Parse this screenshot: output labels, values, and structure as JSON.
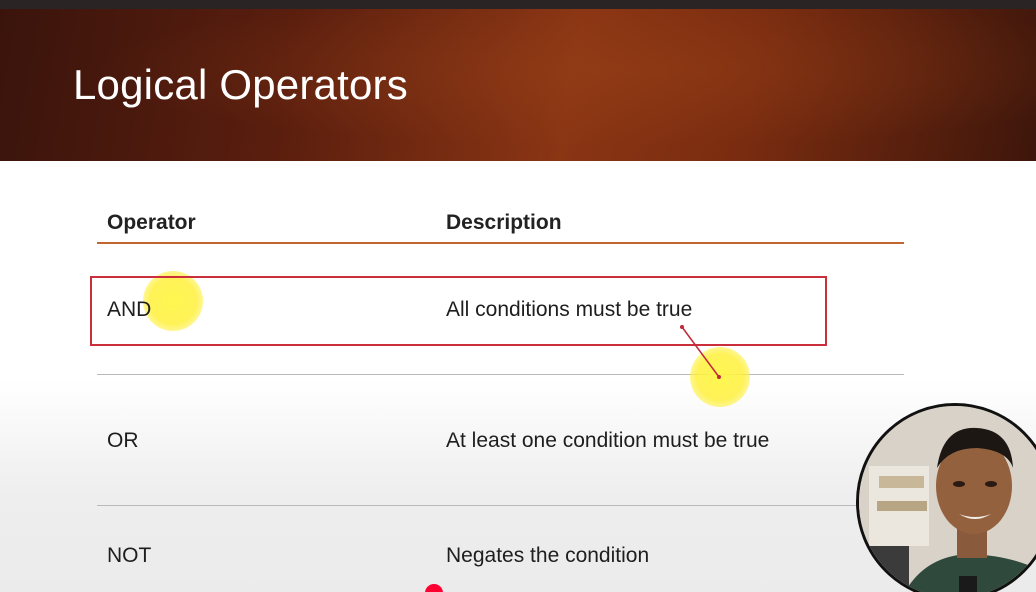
{
  "slide": {
    "title": "Logical Operators"
  },
  "table": {
    "headers": {
      "operator": "Operator",
      "description": "Description"
    },
    "rows": [
      {
        "operator": "AND",
        "description": "All conditions must be true"
      },
      {
        "operator": "OR",
        "description": "At least one condition must be true"
      },
      {
        "operator": "NOT",
        "description": "Negates the condition"
      }
    ]
  },
  "annotations": {
    "highlight_color": "#cc2f3c",
    "cursor_color": "#fff646",
    "header_rule_color": "#c0662e"
  },
  "player": {
    "progress_dot_color": "#ff0033"
  }
}
